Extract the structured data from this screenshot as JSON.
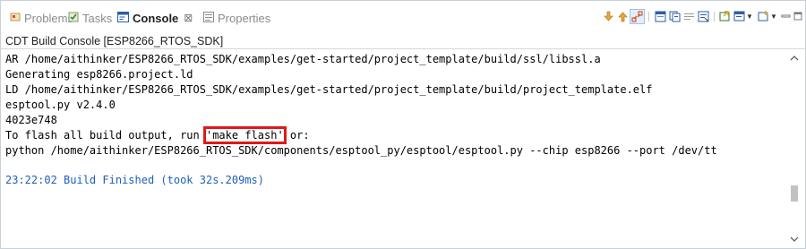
{
  "tabs": [
    {
      "label": "Problems",
      "icon": "problems-icon",
      "active": false
    },
    {
      "label": "Tasks",
      "icon": "tasks-icon",
      "active": false
    },
    {
      "label": "Console",
      "icon": "console-icon",
      "active": true,
      "close": "⊠"
    },
    {
      "label": "Properties",
      "icon": "properties-icon",
      "active": false
    }
  ],
  "toolbar": {
    "icons": [
      "scroll-lock-down-icon",
      "scroll-lock-up-icon",
      "link-icon",
      "clear-console-icon",
      "copy-icon",
      "word-wrap-icon",
      "pin-console-icon",
      "open-console-icon",
      "display-console-icon",
      "new-console-icon",
      "minimize-icon",
      "maximize-icon"
    ]
  },
  "console": {
    "title": "CDT Build Console [ESP8266_RTOS_SDK]",
    "lines": [
      "AR /home/aithinker/ESP8266_RTOS_SDK/examples/get-started/project_template/build/ssl/libssl.a",
      "Generating esp8266.project.ld",
      "LD /home/aithinker/ESP8266_RTOS_SDK/examples/get-started/project_template/build/project_template.elf",
      "esptool.py v2.4.0",
      "4023e748"
    ],
    "flash_line": {
      "prefix": "To flash all build output, run ",
      "highlight": "'make flash'",
      "suffix": " or:"
    },
    "python_line": "python /home/aithinker/ESP8266_RTOS_SDK/components/esptool_py/esptool/esptool.py --chip esp8266 --port /dev/tt",
    "finished": "23:22:02 Build Finished (took 32s.209ms)"
  },
  "colors": {
    "accent": "#1e5ebe",
    "highlight_box": "#e01818"
  }
}
